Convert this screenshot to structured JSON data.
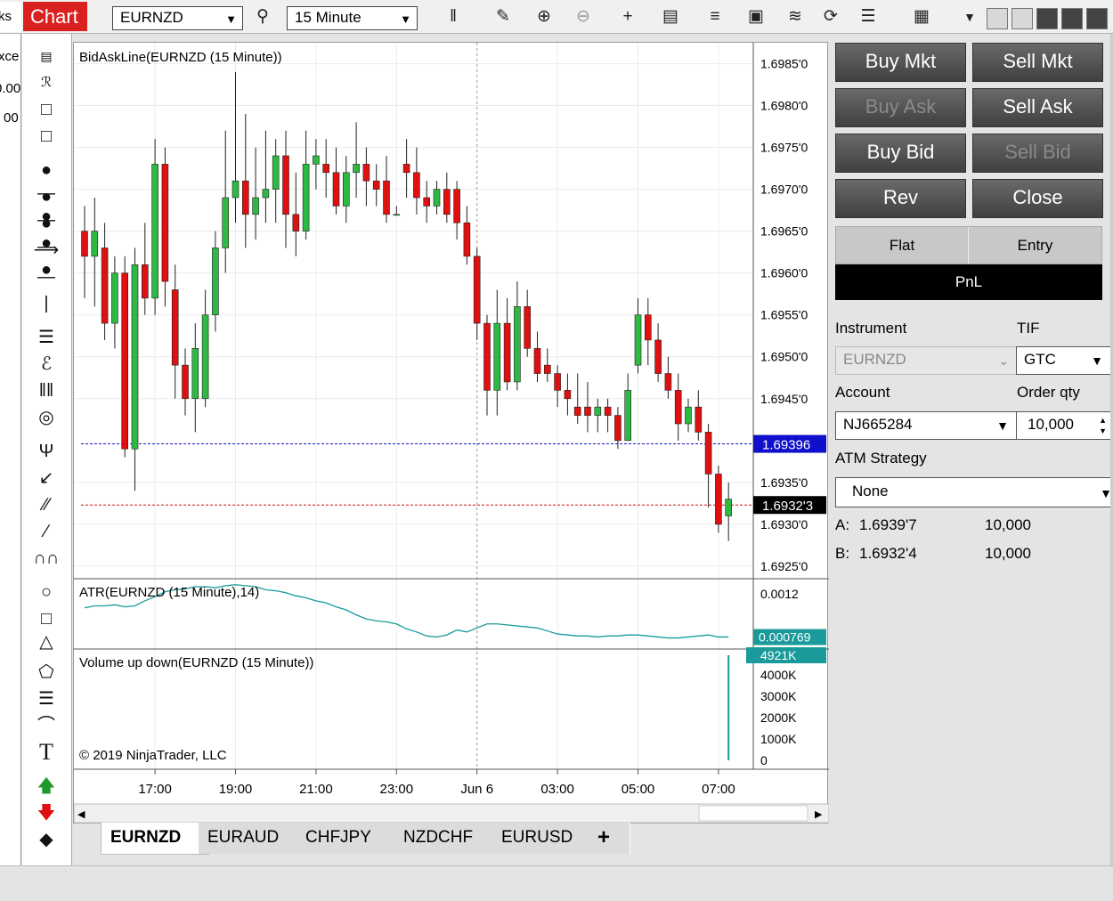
{
  "app": {
    "window_tab": "Chart",
    "instrument": "EURNZD",
    "interval": "15 Minute",
    "cut_left_texts": [
      "ks",
      "xce",
      "0.00",
      "00"
    ]
  },
  "trade": {
    "buy_mkt": "Buy Mkt",
    "sell_mkt": "Sell Mkt",
    "buy_ask": "Buy Ask",
    "sell_ask": "Sell Ask",
    "buy_bid": "Buy Bid",
    "sell_bid": "Sell Bid",
    "rev": "Rev",
    "close": "Close",
    "flat": "Flat",
    "entry": "Entry",
    "pnl": "PnL",
    "instrument_label": "Instrument",
    "instrument_value": "EURNZD",
    "tif_label": "TIF",
    "tif_value": "GTC",
    "account_label": "Account",
    "account_value": "NJ665284",
    "qty_label": "Order qty",
    "qty_value": "10,000",
    "atm_label": "ATM Strategy",
    "atm_value": "None",
    "ask_label": "A:",
    "ask_price": "1.6939'7",
    "ask_size": "10,000",
    "bid_label": "B:",
    "bid_price": "1.6932'4",
    "bid_size": "10,000"
  },
  "tabs": [
    "EURNZD",
    "EURAUD",
    "CHFJPY",
    "NZDCHF",
    "EURUSD",
    "+"
  ],
  "colors": {
    "up": "#2db944",
    "down": "#e01010",
    "ask_line": "#1010cc",
    "bid_line": "#cc1010",
    "atr": "#1a9a9a",
    "brand": "#d9211f"
  },
  "chart_data": {
    "type": "candlestick",
    "price_panel": {
      "title": "BidAskLine(EURNZD (15 Minute))",
      "ylim": [
        1.69235,
        1.69875
      ],
      "ticks": [
        {
          "v": 1.6985,
          "label": "1.6985'0"
        },
        {
          "v": 1.698,
          "label": "1.6980'0"
        },
        {
          "v": 1.6975,
          "label": "1.6975'0"
        },
        {
          "v": 1.697,
          "label": "1.6970'0"
        },
        {
          "v": 1.6965,
          "label": "1.6965'0"
        },
        {
          "v": 1.696,
          "label": "1.6960'0"
        },
        {
          "v": 1.6955,
          "label": "1.6955'0"
        },
        {
          "v": 1.695,
          "label": "1.6950'0"
        },
        {
          "v": 1.6945,
          "label": "1.6945'0"
        },
        {
          "v": 1.6935,
          "label": "1.6935'0"
        },
        {
          "v": 1.693,
          "label": "1.6930'0"
        },
        {
          "v": 1.6925,
          "label": "1.6925'0"
        }
      ],
      "ask_line": {
        "value": 1.69396,
        "label": "1.69396"
      },
      "bid_line": {
        "value": 1.69323,
        "label": "1.6932'3"
      },
      "candles": [
        [
          1.6965,
          1.6962,
          1.6968,
          1.6957
        ],
        [
          1.6962,
          1.6965,
          1.6969,
          1.6956
        ],
        [
          1.6963,
          1.6954,
          1.6966,
          1.6952
        ],
        [
          1.6954,
          1.696,
          1.6962,
          1.6951
        ],
        [
          1.696,
          1.6939,
          1.6962,
          1.6938
        ],
        [
          1.6939,
          1.6961,
          1.6963,
          1.6934
        ],
        [
          1.6961,
          1.6957,
          1.6966,
          1.6955
        ],
        [
          1.6957,
          1.6973,
          1.6976,
          1.6955
        ],
        [
          1.6973,
          1.6959,
          1.6975,
          1.6956
        ],
        [
          1.6958,
          1.6949,
          1.6961,
          1.6945
        ],
        [
          1.6949,
          1.6945,
          1.6951,
          1.6943
        ],
        [
          1.6945,
          1.6951,
          1.6954,
          1.6941
        ],
        [
          1.6945,
          1.6955,
          1.6958,
          1.6944
        ],
        [
          1.6955,
          1.6963,
          1.6965,
          1.6953
        ],
        [
          1.6963,
          1.6969,
          1.6977,
          1.696
        ],
        [
          1.6969,
          1.6971,
          1.6984,
          1.6966
        ],
        [
          1.6971,
          1.6967,
          1.6979,
          1.6963
        ],
        [
          1.6967,
          1.6969,
          1.6975,
          1.6964
        ],
        [
          1.6969,
          1.697,
          1.6977,
          1.6966
        ],
        [
          1.697,
          1.6974,
          1.6976,
          1.6966
        ],
        [
          1.6974,
          1.6967,
          1.6977,
          1.6963
        ],
        [
          1.6967,
          1.6965,
          1.6972,
          1.6962
        ],
        [
          1.6965,
          1.6973,
          1.6977,
          1.6964
        ],
        [
          1.6973,
          1.6974,
          1.6976,
          1.697
        ],
        [
          1.6973,
          1.6972,
          1.6976,
          1.6969
        ],
        [
          1.6972,
          1.6968,
          1.6975,
          1.6967
        ],
        [
          1.6968,
          1.6972,
          1.6974,
          1.6966
        ],
        [
          1.6972,
          1.6973,
          1.6978,
          1.6969
        ],
        [
          1.6973,
          1.6971,
          1.6975,
          1.6968
        ],
        [
          1.6971,
          1.697,
          1.6973,
          1.6968
        ],
        [
          1.6971,
          1.6967,
          1.6974,
          1.6966
        ],
        [
          1.6967,
          1.6967,
          1.6968,
          1.6967
        ],
        [
          1.6973,
          1.6972,
          1.6976,
          1.6969
        ],
        [
          1.6972,
          1.6969,
          1.6975,
          1.6967
        ],
        [
          1.6969,
          1.6968,
          1.6971,
          1.6966
        ],
        [
          1.6968,
          1.697,
          1.6971,
          1.6967
        ],
        [
          1.697,
          1.6967,
          1.6972,
          1.6966
        ],
        [
          1.697,
          1.6966,
          1.6971,
          1.6964
        ],
        [
          1.6966,
          1.6962,
          1.6968,
          1.6961
        ],
        [
          1.6962,
          1.6954,
          1.6963,
          1.6952
        ],
        [
          1.6954,
          1.6946,
          1.6955,
          1.6943
        ],
        [
          1.6946,
          1.6954,
          1.6958,
          1.6943
        ],
        [
          1.6954,
          1.6947,
          1.6957,
          1.6946
        ],
        [
          1.6947,
          1.6956,
          1.6959,
          1.6946
        ],
        [
          1.6956,
          1.6951,
          1.6958,
          1.695
        ],
        [
          1.6951,
          1.6948,
          1.6953,
          1.6947
        ],
        [
          1.6949,
          1.6948,
          1.6951,
          1.6947
        ],
        [
          1.6948,
          1.6946,
          1.6949,
          1.6944
        ],
        [
          1.6946,
          1.6945,
          1.6948,
          1.6943
        ],
        [
          1.6944,
          1.6943,
          1.6948,
          1.6942
        ],
        [
          1.6944,
          1.6943,
          1.6947,
          1.6941
        ],
        [
          1.6943,
          1.6944,
          1.6945,
          1.6941
        ],
        [
          1.6944,
          1.6943,
          1.6945,
          1.6941
        ],
        [
          1.6943,
          1.694,
          1.6944,
          1.6939
        ],
        [
          1.694,
          1.6946,
          1.6948,
          1.694
        ],
        [
          1.6949,
          1.6955,
          1.6957,
          1.6948
        ],
        [
          1.6955,
          1.6952,
          1.6957,
          1.6949
        ],
        [
          1.6952,
          1.6948,
          1.6954,
          1.6947
        ],
        [
          1.6948,
          1.6946,
          1.695,
          1.6945
        ],
        [
          1.6946,
          1.6942,
          1.6948,
          1.694
        ],
        [
          1.6942,
          1.6944,
          1.6945,
          1.6941
        ],
        [
          1.6944,
          1.6941,
          1.6946,
          1.694
        ],
        [
          1.6941,
          1.6936,
          1.6942,
          1.6932
        ],
        [
          1.6936,
          1.693,
          1.6937,
          1.6929
        ],
        [
          1.6931,
          1.6933,
          1.6935,
          1.6928
        ]
      ]
    },
    "atr_panel": {
      "title": "ATR(EURNZD (15 Minute),14)",
      "ylim": [
        0.00065,
        0.00135
      ],
      "ticks": [
        {
          "v": 0.0012,
          "label": "0.0012"
        }
      ],
      "last": {
        "value": 0.000769,
        "label": "0.000769"
      },
      "values": [
        0.00106,
        0.00108,
        0.00108,
        0.00109,
        0.00107,
        0.00108,
        0.00113,
        0.00117,
        0.00122,
        0.00124,
        0.00125,
        0.00127,
        0.00127,
        0.00126,
        0.00128,
        0.00129,
        0.00128,
        0.00127,
        0.00124,
        0.00123,
        0.00121,
        0.00118,
        0.00116,
        0.00113,
        0.00111,
        0.00107,
        0.00104,
        0.00099,
        0.00095,
        0.00093,
        0.00092,
        0.0009,
        0.00085,
        0.00082,
        0.00078,
        0.00077,
        0.00079,
        0.00084,
        0.00082,
        0.00086,
        0.0009,
        0.0009,
        0.00089,
        0.00088,
        0.00087,
        0.00086,
        0.00083,
        0.0008,
        0.00079,
        0.00078,
        0.00078,
        0.00077,
        0.00078,
        0.00078,
        0.00079,
        0.00079,
        0.00078,
        0.00077,
        0.00076,
        0.00076,
        0.00077,
        0.00078,
        0.00079,
        0.00077,
        0.00077
      ]
    },
    "volume_panel": {
      "title": "Volume up down(EURNZD (15 Minute))",
      "ylim": [
        0,
        4921
      ],
      "ticks": [
        {
          "v": 4000,
          "label": "4000K"
        },
        {
          "v": 3000,
          "label": "3000K"
        },
        {
          "v": 2000,
          "label": "2000K"
        },
        {
          "v": 1000,
          "label": "1000K"
        },
        {
          "v": 0,
          "label": "0"
        }
      ],
      "last": {
        "value": 4921,
        "label": "4921K"
      },
      "spike_bar_index": 64,
      "copyright": "© 2019 NinjaTrader, LLC"
    },
    "x_labels": [
      {
        "bar": 7,
        "label": "17:00"
      },
      {
        "bar": 15,
        "label": "19:00"
      },
      {
        "bar": 23,
        "label": "21:00"
      },
      {
        "bar": 31,
        "label": "23:00"
      },
      {
        "bar": 39,
        "label": "Jun 6"
      },
      {
        "bar": 47,
        "label": "03:00"
      },
      {
        "bar": 55,
        "label": "05:00"
      },
      {
        "bar": 63,
        "label": "07:00"
      }
    ]
  }
}
